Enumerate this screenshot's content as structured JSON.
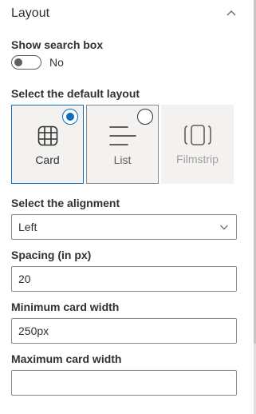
{
  "section": {
    "title": "Layout"
  },
  "search_box": {
    "label": "Show search box",
    "toggle_state_text": "No",
    "enabled": false
  },
  "default_layout": {
    "label": "Select the default layout",
    "options": [
      {
        "label": "Card",
        "icon": "grid-icon",
        "selected": true,
        "enabled": true
      },
      {
        "label": "List",
        "icon": "list-icon",
        "selected": false,
        "enabled": true
      },
      {
        "label": "Filmstrip",
        "icon": "filmstrip-icon",
        "selected": false,
        "enabled": false
      }
    ]
  },
  "alignment": {
    "label": "Select the alignment",
    "value": "Left"
  },
  "spacing": {
    "label": "Spacing (in px)",
    "value": "20"
  },
  "min_card_width": {
    "label": "Minimum card width",
    "value": "250px"
  },
  "max_card_width": {
    "label": "Maximum card width",
    "value": ""
  },
  "colors": {
    "accent": "#0f6cbd",
    "border": "#8a8886",
    "tile_bg": "#f3f2f1"
  }
}
